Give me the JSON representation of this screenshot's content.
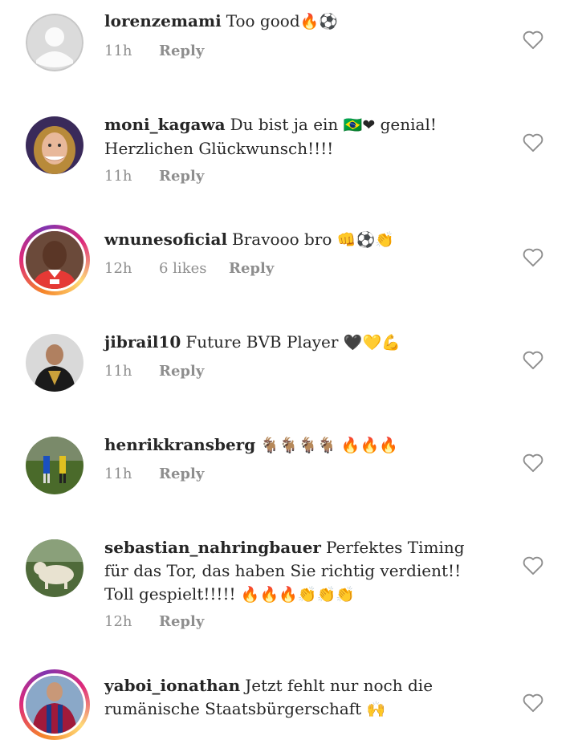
{
  "reply_label": "Reply",
  "colors": {
    "text": "#262626",
    "muted": "#8e8e8e",
    "story_ring_start": "#f58529",
    "story_ring_end": "#dd2a7b"
  },
  "comments": [
    {
      "username": "lorenzemami",
      "text": "Too good",
      "emoji": "🔥⚽",
      "time": "11h",
      "likes": "",
      "avatar": "default-avatar"
    },
    {
      "username": "moni_kagawa",
      "text": "Du bist ja ein",
      "emoji": "🇧🇷❤",
      "text2": "genial! Herzlichen Glückwunsch!!!!",
      "time": "11h",
      "likes": "",
      "avatar": "woman-photo"
    },
    {
      "username": "wnunesoficial",
      "text": "Bravooo bro",
      "emoji": "👊⚽👏",
      "time": "12h",
      "likes": "6 likes",
      "avatar": "player-photo"
    },
    {
      "username": "jibrail10",
      "text": "Future BVB Player",
      "emoji": "🖤💛💪",
      "time": "11h",
      "likes": "",
      "avatar": "man-photo"
    },
    {
      "username": "henrikkransberg",
      "text": "",
      "emoji": "🐐🐐🐐🐐 🔥🔥🔥",
      "time": "11h",
      "likes": "",
      "avatar": "football-field-photo"
    },
    {
      "username": "sebastian_nahringbauer",
      "text": "Perfektes Timing für das Tor, das haben Sie richtig verdient!! Toll gespielt!!!!!",
      "emoji": "🔥🔥🔥👏👏👏",
      "time": "12h",
      "likes": "",
      "avatar": "dog-photo"
    },
    {
      "username": "yaboi_ionathan",
      "text": "Jetzt fehlt nur noch die rumänische Staatsbürgerschaft",
      "emoji": "🙌",
      "time": "",
      "likes": "",
      "avatar": "barca-player-photo"
    }
  ]
}
